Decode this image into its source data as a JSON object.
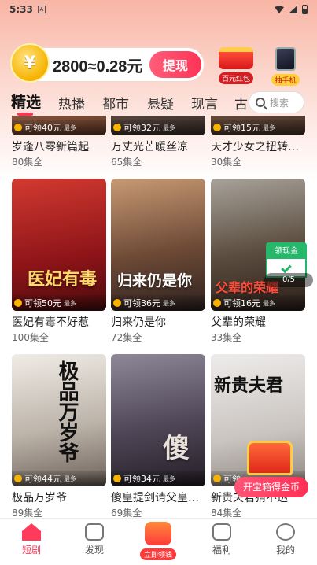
{
  "status_bar": {
    "time": "5:33",
    "notif_icon": "a-icon"
  },
  "coins": {
    "text": "2800≈0.28元",
    "coin_symbol": "¥",
    "withdraw_label": "提现"
  },
  "promos": [
    {
      "label": "百元红包",
      "icon": "red-packet-icon"
    },
    {
      "label": "抽手机",
      "icon": "phone-icon"
    }
  ],
  "tabs": [
    {
      "label": "精选",
      "active": true
    },
    {
      "label": "热播"
    },
    {
      "label": "都市"
    },
    {
      "label": "悬疑"
    },
    {
      "label": "现言"
    },
    {
      "label": "古"
    }
  ],
  "search": {
    "placeholder": "搜索"
  },
  "dramas": [
    {
      "title": "岁逢八零新篇起",
      "episodes": "80集全",
      "reward": "可领40元",
      "reward_tag": "最多",
      "poster_color": "#8a5a3c"
    },
    {
      "title": "万丈光芒暖丝凉",
      "episodes": "65集全",
      "reward": "可领32元",
      "reward_tag": "最多",
      "poster_color": "#5a4a44"
    },
    {
      "title": "天才少女之扭转…",
      "episodes": "30集全",
      "reward": "可领15元",
      "reward_tag": "最多",
      "poster_color": "#6a4e3e"
    },
    {
      "title": "医妃有毒不好惹",
      "episodes": "100集全",
      "reward": "可领50元",
      "reward_tag": "最多",
      "poster_color": "#a3181c",
      "poster_text": "医妃有毒"
    },
    {
      "title": "归来仍是你",
      "episodes": "72集全",
      "reward": "可领36元",
      "reward_tag": "最多",
      "poster_color": "#6b4a3a",
      "poster_text": "归来仍是你"
    },
    {
      "title": "父辈的荣耀",
      "episodes": "33集全",
      "reward": "可领16元",
      "reward_tag": "最多",
      "poster_color": "#6a5a48",
      "poster_text": "父辈的荣耀"
    },
    {
      "title": "极品万岁爷",
      "episodes": "89集全",
      "reward": "可领44元",
      "reward_tag": "最多",
      "poster_color": "#cfcac4",
      "poster_text": "极品万岁爷"
    },
    {
      "title": "傻皇提剑请父皇…",
      "episodes": "69集全",
      "reward": "可领34元",
      "reward_tag": "最多",
      "poster_color": "#6a5f6e",
      "poster_text": "傻"
    },
    {
      "title": "新贵夫君猜不透",
      "episodes": "84集全",
      "reward": "可领",
      "reward_tag": "",
      "poster_color": "#d8d6d4",
      "poster_text": "新贵夫君"
    }
  ],
  "cash_widget": {
    "label": "领现金",
    "progress_text": "0/5",
    "progress": 0
  },
  "chest_cta": "开宝箱得金币",
  "bottom_nav": [
    {
      "label": "短剧",
      "icon": "home-icon",
      "active": true
    },
    {
      "label": "发现",
      "icon": "play-icon"
    },
    {
      "label": "立即领钱",
      "icon": "gift-icon",
      "center": true
    },
    {
      "label": "福利",
      "icon": "welfare-icon"
    },
    {
      "label": "我的",
      "icon": "profile-icon"
    }
  ]
}
